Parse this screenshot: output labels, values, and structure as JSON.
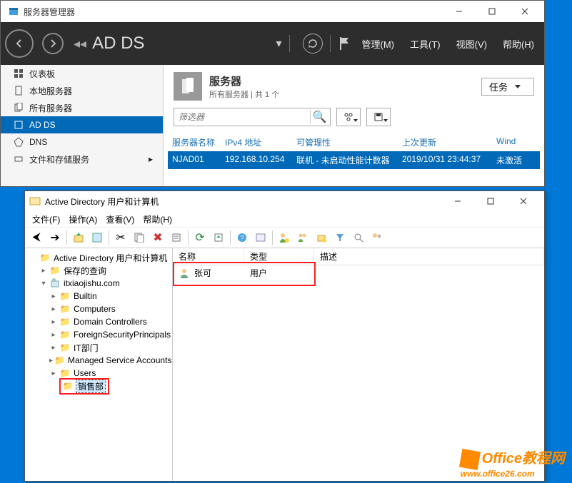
{
  "server_manager": {
    "title": "服务器管理器",
    "breadcrumb_label": "AD DS",
    "menu": {
      "manage": "管理(M)",
      "tools": "工具(T)",
      "view": "视图(V)",
      "help": "帮助(H)"
    },
    "sidebar": [
      {
        "label": "仪表板"
      },
      {
        "label": "本地服务器"
      },
      {
        "label": "所有服务器"
      },
      {
        "label": "AD DS"
      },
      {
        "label": "DNS"
      },
      {
        "label": "文件和存储服务"
      }
    ],
    "servers_panel": {
      "title": "服务器",
      "subtitle": "所有服务器 | 共 1 个",
      "task_btn": "任务",
      "filter_placeholder": "筛选器",
      "columns": {
        "name": "服务器名称",
        "ip": "IPv4 地址",
        "manage": "可管理性",
        "updated": "上次更新",
        "win": "Wind"
      },
      "row": {
        "name": "NJAD01",
        "ip": "192.168.10.254",
        "manage": "联机 - 未启动性能计数器",
        "updated": "2019/10/31 23:44:37",
        "win": "未激活"
      }
    }
  },
  "aduc": {
    "title": "Active Directory 用户和计算机",
    "menus": {
      "file": "文件(F)",
      "action": "操作(A)",
      "view": "查看(V)",
      "help": "帮助(H)"
    },
    "tree": {
      "root": "Active Directory 用户和计算机",
      "saved": "保存的查询",
      "domain": "itxiaojishu.com",
      "nodes": [
        "Builtin",
        "Computers",
        "Domain Controllers",
        "ForeignSecurityPrincipals",
        "IT部门",
        "Managed Service Accounts",
        "Users",
        "销售部"
      ]
    },
    "columns": {
      "name": "名称",
      "type": "类型",
      "desc": "描述"
    },
    "item": {
      "name": "张可",
      "type": "用户"
    }
  },
  "watermark": {
    "brand": "Office教程网",
    "url": "www.office26.com"
  }
}
